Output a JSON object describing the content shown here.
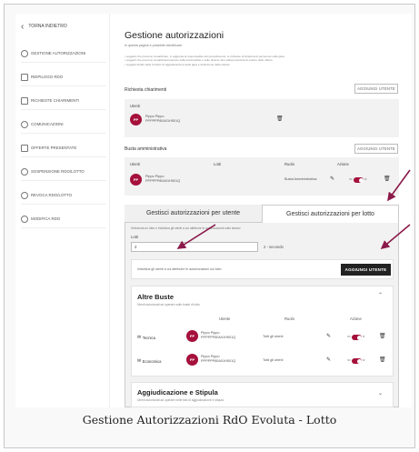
{
  "sidebar": {
    "back_label": "TORNA INDIETRO",
    "items": [
      {
        "label": "GESTIONE AUTORIZZAZIONI",
        "icon": "people-icon"
      },
      {
        "label": "RIEPILOGO RDO",
        "icon": "document-icon"
      },
      {
        "label": "RICHIESTE CHIARIMENTI",
        "icon": "chat-icon"
      },
      {
        "label": "COMUNICAZIONI",
        "icon": "people-icon"
      },
      {
        "label": "OFFERTE PRESENTATE",
        "icon": "document-icon"
      },
      {
        "label": "SOSPENSIONE RDO/LOTTO",
        "icon": "pause-icon"
      },
      {
        "label": "REVOCA RDO/LOTTO",
        "icon": "cancel-icon"
      },
      {
        "label": "MODIFICA RDO",
        "icon": "people-icon"
      }
    ]
  },
  "header": {
    "title": "Gestione autorizzazioni",
    "subtitle": "In questa pagina è possibile identificare:",
    "notes": [
      "• soggetti che possono visualizzare, in aggiunta al responsabile del procedimento, le richieste di chiarimenti pervenute sulla gara",
      "• soggetti che possono visualizzare/operare sulla sezione/fasi e sulle diverse fasi sulla procedura di esame delle offerte",
      "• soggetti titolari delle funzioni di aggiudicazione della gara e definizione della stipula"
    ]
  },
  "richiesta": {
    "label": "Richiesta chiarimenti",
    "add_button": "AGGIUNGI UTENTE",
    "users_label": "Utenti",
    "user": {
      "initials": "PP",
      "name": "Pippo Pippo",
      "code": "PPPPPP80A01H501Q"
    }
  },
  "busta": {
    "label": "Busta amministrativa",
    "add_button": "AGGIUNGI UTENTE",
    "headers": {
      "utenti": "Utenti",
      "lotti": "Lotti",
      "ruolo": "Ruolo",
      "azione": "Azione"
    },
    "user": {
      "initials": "PP",
      "name": "Pippo Pippo",
      "code": "PPPPPP80A01H501Q",
      "ruolo": "Busta Amministrativa"
    },
    "toggle_off": "no",
    "toggle_on": "si"
  },
  "tabs": [
    {
      "label": "Gestisci autorizzazioni per utente",
      "active": false
    },
    {
      "label": "Gestisci autorizzazioni per lotto",
      "active": true
    }
  ],
  "lotto_panel": {
    "instruction": "Seleziona un lotto e individua gli utenti a cui attribuire le autorizzazioni sullo stesso",
    "lotti_label": "Lotti",
    "lotti_value": "2",
    "lotti_hint": "2 - secondo",
    "individua": "Individua gli utenti a cui attribuire le autorizzazioni sul lotto",
    "add_button": "AGGIUNGI UTENTE"
  },
  "altre_buste": {
    "title": "Altre Buste",
    "subtitle": "Utenti autorizzati ad operare sulle buste di lotto",
    "headers": {
      "utente": "Utente",
      "ruolo": "Ruolo",
      "azione": "Azione"
    },
    "rows": [
      {
        "category": "Tecnica",
        "initials": "PP",
        "name": "Pippo Pippo",
        "code": "PPPPPP80A01H501Q",
        "ruolo": "Tutti gli utenti"
      },
      {
        "category": "Economica",
        "initials": "PP",
        "name": "Pippo Pippo",
        "code": "PPPPPP80A01H501Q",
        "ruolo": "Tutti gli utenti"
      }
    ],
    "toggle_off": "no",
    "toggle_on": "si"
  },
  "aggiudicazione": {
    "title": "Aggiudicazione e Stipula",
    "subtitle": "Utenti autorizzati ad operare nelle fasi di aggiudicazione e stipula"
  },
  "caption": "Gestione Autorizzazioni RdO Evoluta - Lotto",
  "colors": {
    "accent": "#a5113b",
    "arrow": "#8b1a4a",
    "dark_button": "#222222"
  }
}
